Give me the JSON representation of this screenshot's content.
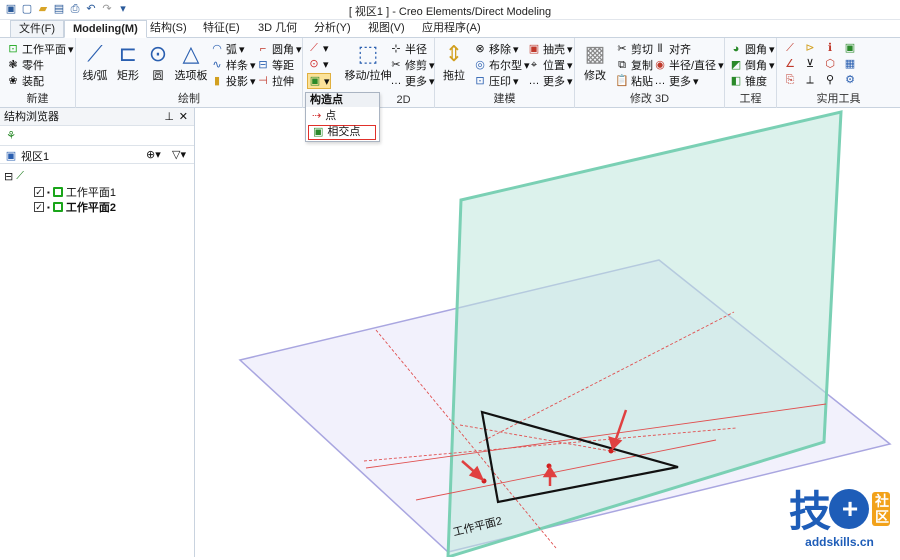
{
  "window": {
    "title": "[ 视区1 ] - Creo Elements/Direct Modeling"
  },
  "tabs": [
    {
      "label": "文件(F)"
    },
    {
      "label": "Modeling(M)"
    },
    {
      "label": "结构(S)"
    },
    {
      "label": "特征(E)"
    },
    {
      "label": "3D 几何"
    },
    {
      "label": "分析(Y)"
    },
    {
      "label": "视图(V)"
    },
    {
      "label": "应用程序(A)"
    }
  ],
  "ribbon": {
    "new_group": {
      "label": "新建",
      "workplane": "工作平面",
      "part": "零件",
      "assembly": "装配"
    },
    "draw_group": {
      "label": "绘制",
      "line_arc": "线/弧",
      "rect": "矩形",
      "circle": "圆",
      "palette": "选项板",
      "arc": "弧",
      "spline": "样条",
      "project": "投影",
      "fillet": "圆角",
      "offset": "等距",
      "extend": "拉伸"
    },
    "edit2d_group": {
      "label": "2D",
      "move_extrude": "移动/拉伸",
      "radius": "半径",
      "trim": "修剪",
      "more": "更多"
    },
    "model_group": {
      "label": "建模",
      "pull": "拖拉",
      "move": "移除",
      "boolean": "布尔型",
      "imprint": "压印",
      "shell": "抽壳",
      "position": "位置",
      "more": "更多"
    },
    "modify3d_group": {
      "label": "修改 3D",
      "modify": "修改",
      "cut": "剪切",
      "copy": "复制",
      "paste": "粘贴",
      "align": "对齐",
      "radius_dia": "半径/直径",
      "more": "更多"
    },
    "eng_group": {
      "label": "工程",
      "round": "圆角",
      "chamfer": "倒角",
      "taper": "锥度"
    },
    "util_group": {
      "label": "实用工具"
    }
  },
  "dropdown": {
    "header": "构造点",
    "items": [
      {
        "label": "点"
      },
      {
        "label": "相交点"
      }
    ]
  },
  "browser": {
    "title": "结构浏览器",
    "viewport": "视区1",
    "items": [
      {
        "label": "工作平面1"
      },
      {
        "label": "工作平面2"
      }
    ]
  },
  "canvas": {
    "plane_label": "工作平面2"
  },
  "logo": {
    "main": "技",
    "box_top": "社",
    "box_bottom": "区",
    "url": "addskills.cn"
  }
}
